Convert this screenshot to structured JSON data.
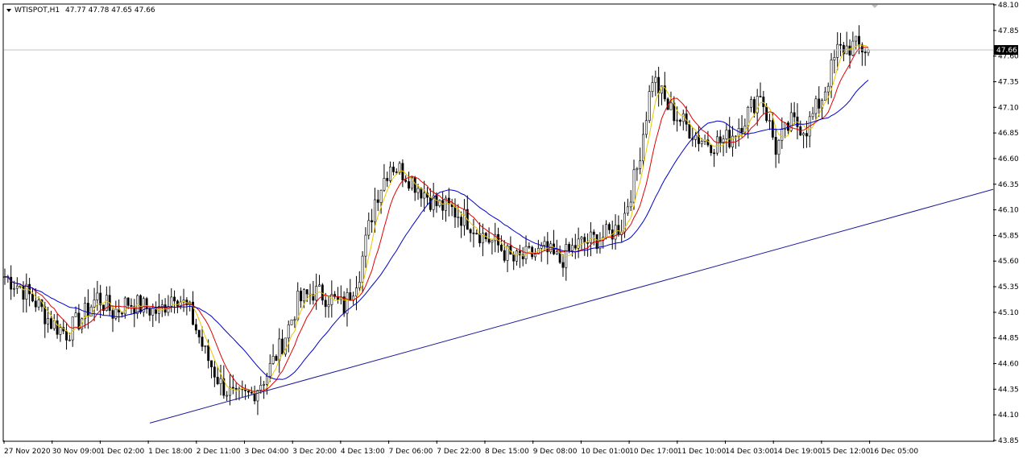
{
  "header": {
    "symbol": "WTISPOT,H1",
    "ohlc": "47.77 47.78 47.65 47.66"
  },
  "chart_data": {
    "type": "candlestick",
    "symbol": "WTISPOT",
    "timeframe": "H1",
    "last_open": 47.77,
    "last_high": 47.78,
    "last_low": 47.65,
    "last_close": 47.66,
    "current_price": 47.66,
    "current_price_label": "47.66",
    "ylim": [
      43.85,
      48.1
    ],
    "y_ticks": [
      "48.10",
      "47.85",
      "47.60",
      "47.35",
      "47.10",
      "46.85",
      "46.60",
      "46.35",
      "46.10",
      "45.85",
      "45.60",
      "45.35",
      "45.10",
      "44.85",
      "44.60",
      "44.35",
      "44.10",
      "43.85"
    ],
    "x_ticks": [
      "27 Nov 2020",
      "30 Nov 09:00",
      "1 Dec 02:00",
      "1 Dec 18:00",
      "2 Dec 11:00",
      "3 Dec 04:00",
      "3 Dec 20:00",
      "4 Dec 13:00",
      "7 Dec 06:00",
      "7 Dec 22:00",
      "8 Dec 15:00",
      "9 Dec 08:00",
      "10 Dec 01:00",
      "10 Dec 17:00",
      "11 Dec 10:00",
      "14 Dec 03:00",
      "14 Dec 19:00",
      "15 Dec 12:00",
      "16 Dec 05:00"
    ],
    "close_path": [
      45.45,
      45.35,
      45.2,
      45.0,
      44.9,
      45.05,
      45.25,
      45.1,
      45.2,
      45.15,
      45.1,
      45.3,
      45.1,
      44.7,
      44.4,
      44.25,
      44.3,
      44.5,
      44.8,
      45.2,
      45.3,
      45.25,
      45.15,
      45.5,
      46.2,
      46.55,
      46.45,
      46.3,
      46.15,
      46.1,
      46.0,
      45.85,
      45.75,
      45.6,
      45.65,
      45.7,
      45.6,
      45.75,
      45.8,
      45.85,
      45.95,
      46.5,
      47.4,
      47.1,
      46.95,
      46.8,
      46.75,
      46.8,
      47.0,
      47.25,
      46.7,
      46.95,
      46.9,
      47.2,
      47.65,
      47.7,
      47.66
    ],
    "trendline": {
      "from": [
        "1 Dec 18:00",
        44.02
      ],
      "to": [
        "16 Dec 05:00+",
        46.3
      ]
    },
    "ma_colors": {
      "fast": "#e6c800",
      "mid": "#e00000",
      "slow": "#0000cc"
    },
    "candle_colors": {
      "body": "#000000",
      "wick": "#000000",
      "up_fill": "#ffffff",
      "down_fill": "#000000"
    },
    "grid": false,
    "legend": "none"
  }
}
